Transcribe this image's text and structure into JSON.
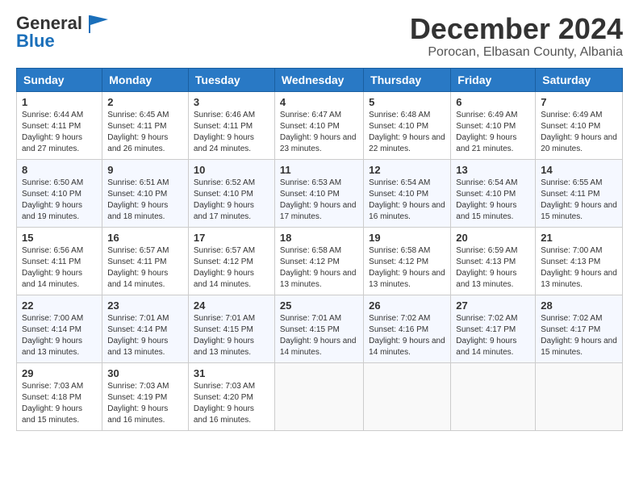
{
  "header": {
    "logo_general": "General",
    "logo_blue": "Blue",
    "month": "December 2024",
    "location": "Porocan, Elbasan County, Albania"
  },
  "weekdays": [
    "Sunday",
    "Monday",
    "Tuesday",
    "Wednesday",
    "Thursday",
    "Friday",
    "Saturday"
  ],
  "weeks": [
    [
      {
        "day": "1",
        "sunrise": "Sunrise: 6:44 AM",
        "sunset": "Sunset: 4:11 PM",
        "daylight": "Daylight: 9 hours and 27 minutes."
      },
      {
        "day": "2",
        "sunrise": "Sunrise: 6:45 AM",
        "sunset": "Sunset: 4:11 PM",
        "daylight": "Daylight: 9 hours and 26 minutes."
      },
      {
        "day": "3",
        "sunrise": "Sunrise: 6:46 AM",
        "sunset": "Sunset: 4:11 PM",
        "daylight": "Daylight: 9 hours and 24 minutes."
      },
      {
        "day": "4",
        "sunrise": "Sunrise: 6:47 AM",
        "sunset": "Sunset: 4:10 PM",
        "daylight": "Daylight: 9 hours and 23 minutes."
      },
      {
        "day": "5",
        "sunrise": "Sunrise: 6:48 AM",
        "sunset": "Sunset: 4:10 PM",
        "daylight": "Daylight: 9 hours and 22 minutes."
      },
      {
        "day": "6",
        "sunrise": "Sunrise: 6:49 AM",
        "sunset": "Sunset: 4:10 PM",
        "daylight": "Daylight: 9 hours and 21 minutes."
      },
      {
        "day": "7",
        "sunrise": "Sunrise: 6:49 AM",
        "sunset": "Sunset: 4:10 PM",
        "daylight": "Daylight: 9 hours and 20 minutes."
      }
    ],
    [
      {
        "day": "8",
        "sunrise": "Sunrise: 6:50 AM",
        "sunset": "Sunset: 4:10 PM",
        "daylight": "Daylight: 9 hours and 19 minutes."
      },
      {
        "day": "9",
        "sunrise": "Sunrise: 6:51 AM",
        "sunset": "Sunset: 4:10 PM",
        "daylight": "Daylight: 9 hours and 18 minutes."
      },
      {
        "day": "10",
        "sunrise": "Sunrise: 6:52 AM",
        "sunset": "Sunset: 4:10 PM",
        "daylight": "Daylight: 9 hours and 17 minutes."
      },
      {
        "day": "11",
        "sunrise": "Sunrise: 6:53 AM",
        "sunset": "Sunset: 4:10 PM",
        "daylight": "Daylight: 9 hours and 17 minutes."
      },
      {
        "day": "12",
        "sunrise": "Sunrise: 6:54 AM",
        "sunset": "Sunset: 4:10 PM",
        "daylight": "Daylight: 9 hours and 16 minutes."
      },
      {
        "day": "13",
        "sunrise": "Sunrise: 6:54 AM",
        "sunset": "Sunset: 4:10 PM",
        "daylight": "Daylight: 9 hours and 15 minutes."
      },
      {
        "day": "14",
        "sunrise": "Sunrise: 6:55 AM",
        "sunset": "Sunset: 4:11 PM",
        "daylight": "Daylight: 9 hours and 15 minutes."
      }
    ],
    [
      {
        "day": "15",
        "sunrise": "Sunrise: 6:56 AM",
        "sunset": "Sunset: 4:11 PM",
        "daylight": "Daylight: 9 hours and 14 minutes."
      },
      {
        "day": "16",
        "sunrise": "Sunrise: 6:57 AM",
        "sunset": "Sunset: 4:11 PM",
        "daylight": "Daylight: 9 hours and 14 minutes."
      },
      {
        "day": "17",
        "sunrise": "Sunrise: 6:57 AM",
        "sunset": "Sunset: 4:12 PM",
        "daylight": "Daylight: 9 hours and 14 minutes."
      },
      {
        "day": "18",
        "sunrise": "Sunrise: 6:58 AM",
        "sunset": "Sunset: 4:12 PM",
        "daylight": "Daylight: 9 hours and 13 minutes."
      },
      {
        "day": "19",
        "sunrise": "Sunrise: 6:58 AM",
        "sunset": "Sunset: 4:12 PM",
        "daylight": "Daylight: 9 hours and 13 minutes."
      },
      {
        "day": "20",
        "sunrise": "Sunrise: 6:59 AM",
        "sunset": "Sunset: 4:13 PM",
        "daylight": "Daylight: 9 hours and 13 minutes."
      },
      {
        "day": "21",
        "sunrise": "Sunrise: 7:00 AM",
        "sunset": "Sunset: 4:13 PM",
        "daylight": "Daylight: 9 hours and 13 minutes."
      }
    ],
    [
      {
        "day": "22",
        "sunrise": "Sunrise: 7:00 AM",
        "sunset": "Sunset: 4:14 PM",
        "daylight": "Daylight: 9 hours and 13 minutes."
      },
      {
        "day": "23",
        "sunrise": "Sunrise: 7:01 AM",
        "sunset": "Sunset: 4:14 PM",
        "daylight": "Daylight: 9 hours and 13 minutes."
      },
      {
        "day": "24",
        "sunrise": "Sunrise: 7:01 AM",
        "sunset": "Sunset: 4:15 PM",
        "daylight": "Daylight: 9 hours and 13 minutes."
      },
      {
        "day": "25",
        "sunrise": "Sunrise: 7:01 AM",
        "sunset": "Sunset: 4:15 PM",
        "daylight": "Daylight: 9 hours and 14 minutes."
      },
      {
        "day": "26",
        "sunrise": "Sunrise: 7:02 AM",
        "sunset": "Sunset: 4:16 PM",
        "daylight": "Daylight: 9 hours and 14 minutes."
      },
      {
        "day": "27",
        "sunrise": "Sunrise: 7:02 AM",
        "sunset": "Sunset: 4:17 PM",
        "daylight": "Daylight: 9 hours and 14 minutes."
      },
      {
        "day": "28",
        "sunrise": "Sunrise: 7:02 AM",
        "sunset": "Sunset: 4:17 PM",
        "daylight": "Daylight: 9 hours and 15 minutes."
      }
    ],
    [
      {
        "day": "29",
        "sunrise": "Sunrise: 7:03 AM",
        "sunset": "Sunset: 4:18 PM",
        "daylight": "Daylight: 9 hours and 15 minutes."
      },
      {
        "day": "30",
        "sunrise": "Sunrise: 7:03 AM",
        "sunset": "Sunset: 4:19 PM",
        "daylight": "Daylight: 9 hours and 16 minutes."
      },
      {
        "day": "31",
        "sunrise": "Sunrise: 7:03 AM",
        "sunset": "Sunset: 4:20 PM",
        "daylight": "Daylight: 9 hours and 16 minutes."
      },
      null,
      null,
      null,
      null
    ]
  ]
}
